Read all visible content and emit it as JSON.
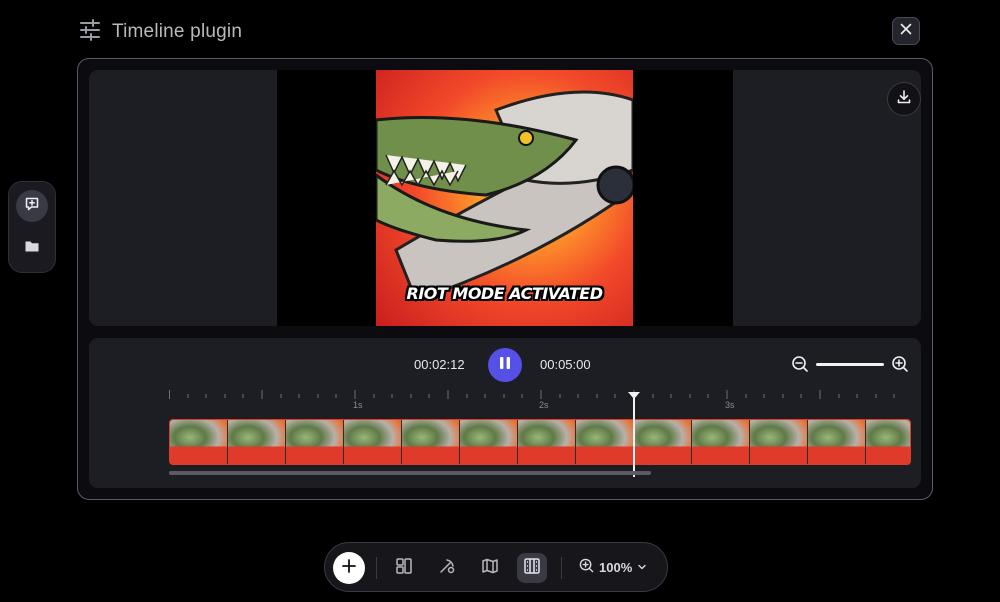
{
  "header": {
    "title": "Timeline plugin",
    "icon": "sliders-icon"
  },
  "window": {
    "close_icon": "close-icon"
  },
  "left_rail": {
    "items": [
      {
        "name": "add-comment",
        "icon": "comment-plus-icon",
        "active": true
      },
      {
        "name": "folder",
        "icon": "folder-icon",
        "active": false
      }
    ]
  },
  "preview": {
    "caption": "RIOT MODE ACTIVATED",
    "download_icon": "download-icon"
  },
  "player": {
    "current_time": "00:02:12",
    "total_time": "00:05:00",
    "state": "playing",
    "pause_icon": "pause-icon",
    "zoom_out_icon": "zoom-out-icon",
    "zoom_in_icon": "zoom-in-icon",
    "zoom_level": 1.0
  },
  "ruler": {
    "labels": [
      "1s",
      "2s",
      "3s"
    ]
  },
  "track": {
    "clip_frames": 13,
    "playhead_time": "00:02:12"
  },
  "toolbar": {
    "add_icon": "plus-icon",
    "tools": [
      {
        "name": "layout",
        "icon": "layout-icon",
        "active": false
      },
      {
        "name": "effects",
        "icon": "magic-icon",
        "active": false
      },
      {
        "name": "map",
        "icon": "map-icon",
        "active": false
      },
      {
        "name": "timeline",
        "icon": "timeline-icon",
        "active": true
      }
    ],
    "zoom_label": "100%",
    "zoom_icon": "zoom-in-icon"
  },
  "colors": {
    "accent": "#5550e6",
    "panel": "#1d1d24",
    "clip_border": "#d9402a"
  }
}
